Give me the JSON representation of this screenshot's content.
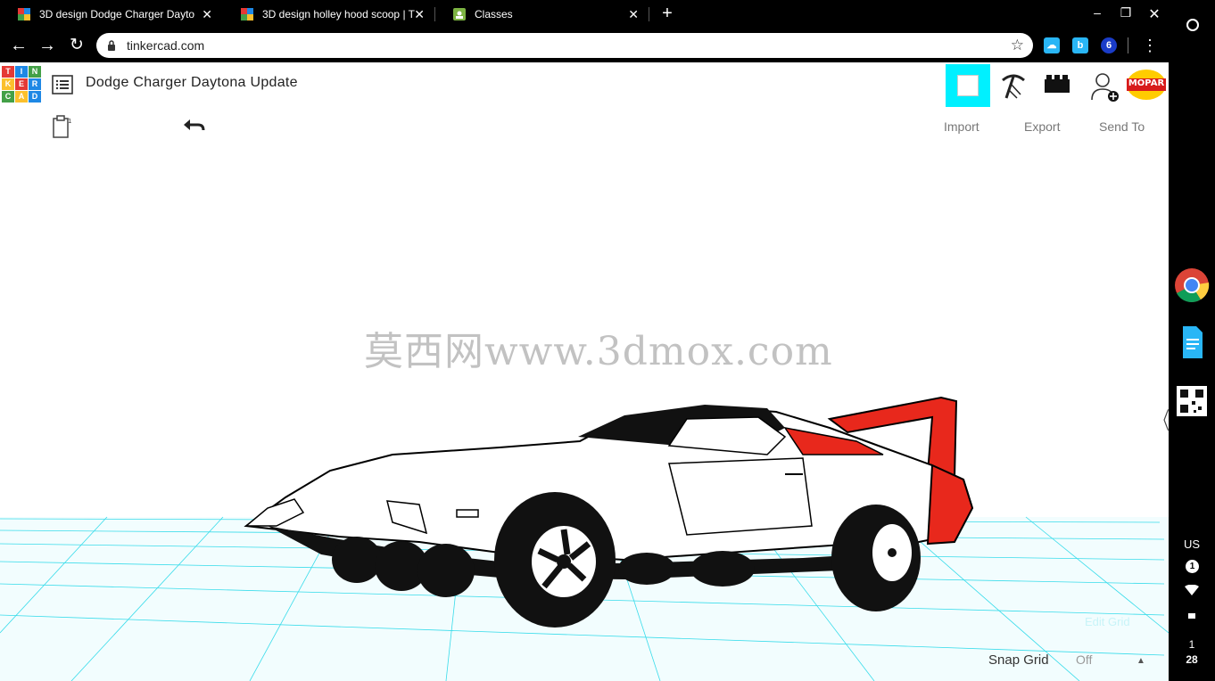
{
  "browser": {
    "tabs": [
      {
        "title": "3D design Dodge Charger Dayto",
        "active": true
      },
      {
        "title": "3D design holley hood scoop | T",
        "active": false
      },
      {
        "title": "Classes",
        "active": false
      }
    ],
    "url": "tinkercad.com",
    "extensions": [
      "b",
      "6"
    ]
  },
  "app": {
    "logo_letters": [
      "T",
      "I",
      "N",
      "K",
      "E",
      "R",
      "C",
      "A",
      "D"
    ],
    "logo_colors": [
      "#e53935",
      "#1e88e5",
      "#43a047",
      "#fbc02d",
      "#e53935",
      "#1e88e5",
      "#43a047",
      "#fbc02d",
      "#1e88e5"
    ],
    "design_title": "Dodge Charger Daytona Update",
    "top_actions": {
      "import_label": "Import",
      "export_label": "Export",
      "send_to_label": "Send To"
    },
    "avatar_text": "MOPAR",
    "watermark": "莫西网www.3dmox.com",
    "edit_grid_label": "Edit Grid",
    "snap_grid_label": "Snap Grid",
    "snap_grid_value": "Off"
  },
  "shelf": {
    "keyboard": "US",
    "notification_count": "1",
    "time_hour": "1",
    "time_min": "28"
  },
  "colors": {
    "accent_cyan": "#00f0ff",
    "spoiler_red": "#e8281c",
    "grid_cyan": "#22d8e8"
  }
}
